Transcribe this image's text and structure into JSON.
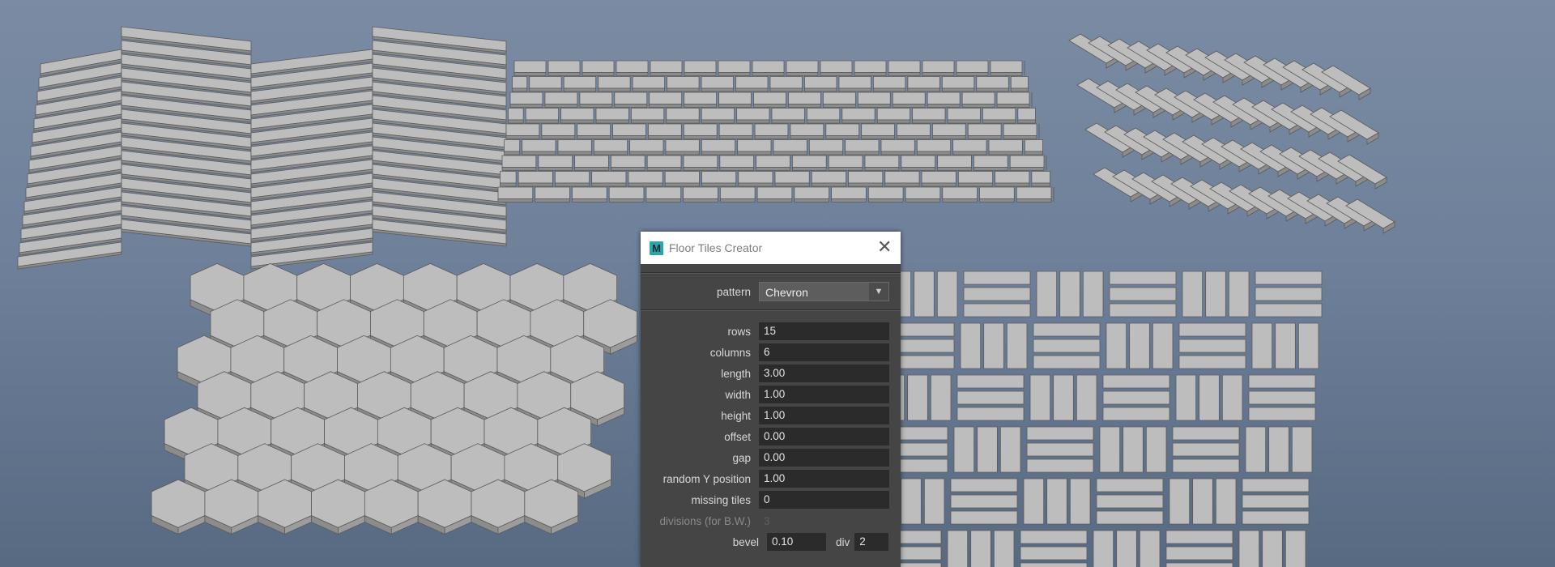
{
  "dialog": {
    "title": "Floor Tiles Creator",
    "app_icon": "M",
    "close_glyph": "✕",
    "pattern": {
      "label": "pattern",
      "value": "Chevron",
      "chevron": "▼"
    },
    "fields": {
      "rows": {
        "label": "rows",
        "value": "15"
      },
      "columns": {
        "label": "columns",
        "value": "6"
      },
      "length": {
        "label": "length",
        "value": "3.00"
      },
      "width": {
        "label": "width",
        "value": "1.00"
      },
      "height": {
        "label": "height",
        "value": "1.00"
      },
      "offset": {
        "label": "offset",
        "value": "0.00"
      },
      "gap": {
        "label": "gap",
        "value": "0.00"
      },
      "random_y": {
        "label": "random Y position",
        "value": "1.00"
      },
      "missing": {
        "label": "missing tiles",
        "value": "0"
      },
      "divisions": {
        "label": "divisions (for B.W.)",
        "value": "3"
      },
      "bevel": {
        "label": "bevel",
        "value": "0.10"
      },
      "div": {
        "label": "div",
        "value": "2"
      }
    }
  },
  "viewport": {
    "background_top": "#7a8ba3",
    "background_bottom": "#586a82",
    "tile_color": "#b5b5b5",
    "patterns": [
      "chevron",
      "running-bond-brick",
      "herringbone",
      "hexagon",
      "basket-weave"
    ]
  }
}
